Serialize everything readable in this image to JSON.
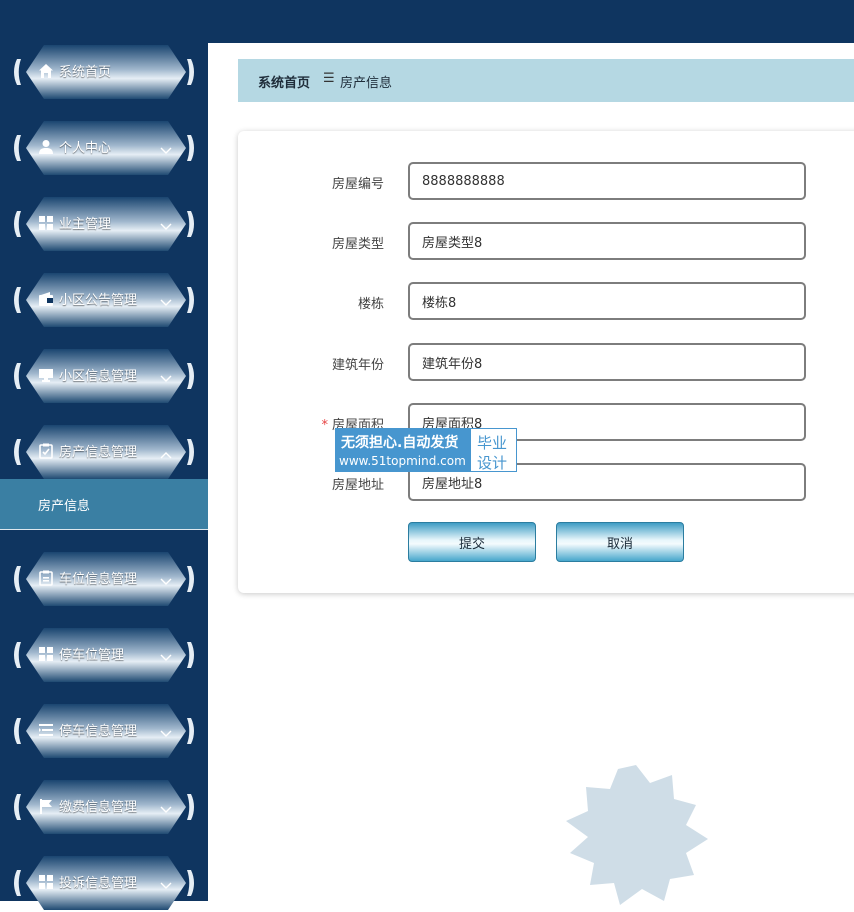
{
  "sidebar": {
    "items": [
      {
        "label": "系统首页",
        "icon": "home-icon",
        "has_chevron": false
      },
      {
        "label": "个人中心",
        "icon": "user-icon",
        "has_chevron": true
      },
      {
        "label": "业主管理",
        "icon": "grid-icon",
        "has_chevron": true
      },
      {
        "label": "小区公告管理",
        "icon": "wallet-icon",
        "has_chevron": true
      },
      {
        "label": "小区信息管理",
        "icon": "monitor-icon",
        "has_chevron": true
      },
      {
        "label": "房产信息管理",
        "icon": "clipboard-check-icon",
        "has_chevron": true,
        "expanded": true
      },
      {
        "label": "车位信息管理",
        "icon": "clipboard-icon",
        "has_chevron": true
      },
      {
        "label": "停车位管理",
        "icon": "grid-icon",
        "has_chevron": true
      },
      {
        "label": "停车信息管理",
        "icon": "list-icon",
        "has_chevron": true
      },
      {
        "label": "缴费信息管理",
        "icon": "flag-icon",
        "has_chevron": true
      },
      {
        "label": "投诉信息管理",
        "icon": "grid-icon",
        "has_chevron": true
      }
    ],
    "submenu": {
      "label": "房产信息"
    }
  },
  "breadcrumb": {
    "home": "系统首页",
    "separator": "☰",
    "current": "房产信息"
  },
  "form": {
    "fields": [
      {
        "label": "房屋编号",
        "value": "8888888888",
        "required": false
      },
      {
        "label": "房屋类型",
        "value": "房屋类型8",
        "required": false
      },
      {
        "label": "楼栋",
        "value": "楼栋8",
        "required": false
      },
      {
        "label": "建筑年份",
        "value": "建筑年份8",
        "required": false
      },
      {
        "label": "房屋面积",
        "value": "房屋面积8",
        "required": true
      },
      {
        "label": "房屋地址",
        "value": "房屋地址8",
        "required": false
      }
    ],
    "submit_label": "提交",
    "cancel_label": "取消"
  },
  "watermark": {
    "line1": "无须担心.自动发货",
    "line2": "www.51topmind.com",
    "right1": "毕业",
    "right2": "设计"
  },
  "colors": {
    "sidebar": "#0f3560",
    "breadcrumb": "#b5d8e3",
    "submenu": "#3a7fa3",
    "required": "#e64242"
  }
}
